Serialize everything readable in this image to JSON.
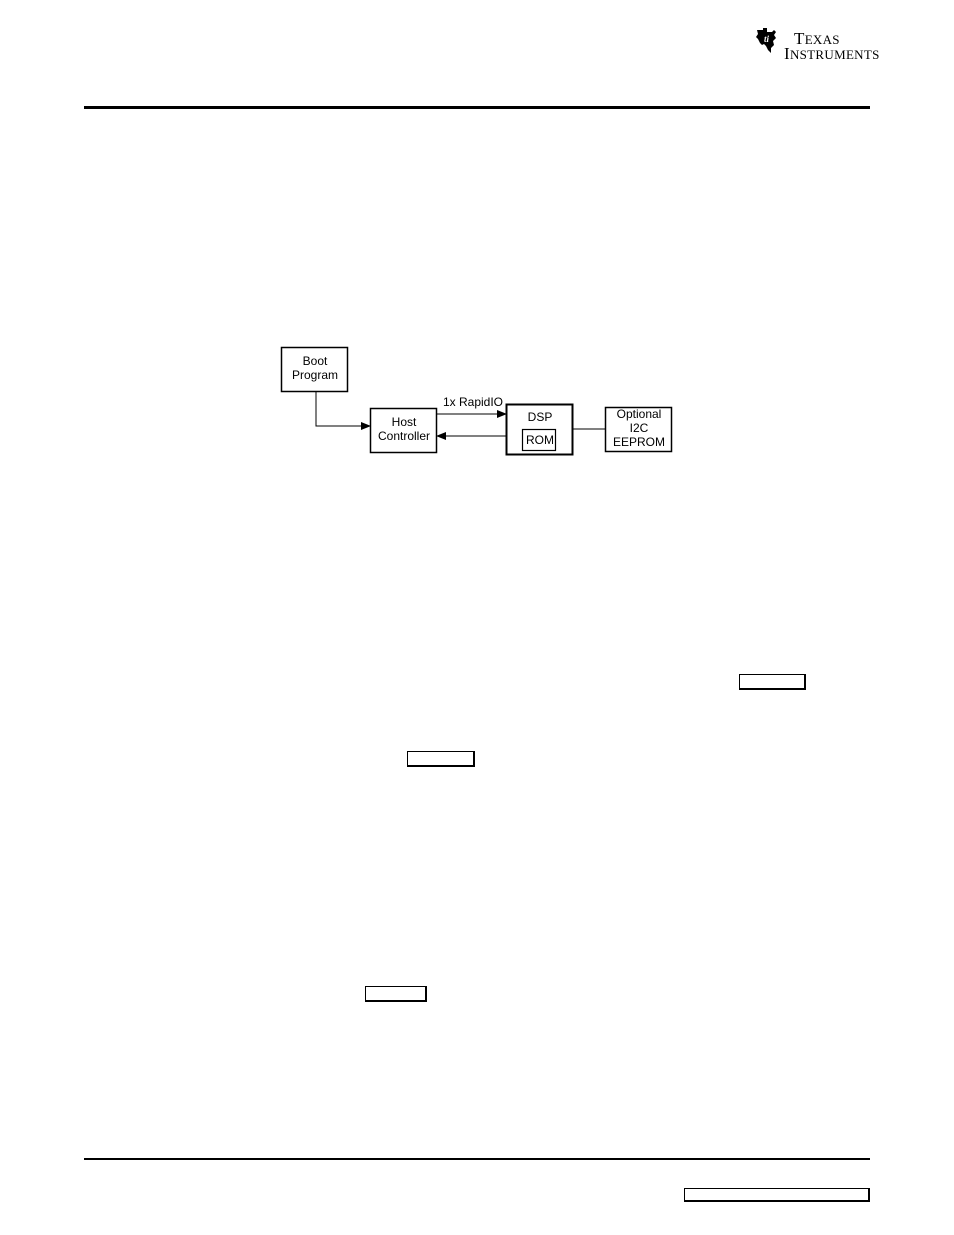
{
  "header": {
    "logo": {
      "icon": "ti-texas-logo-icon",
      "line1_initial": "T",
      "line1_rest": "EXAS",
      "line2_initial": "I",
      "line2_rest": "NSTRUMENTS"
    }
  },
  "figure": {
    "nodes": {
      "boot_program": "Boot\nProgram",
      "host_controller": "Host\nController",
      "dsp": "DSP",
      "rom": "ROM",
      "optional_eeprom": "Optional\nI2C\nEEPROM"
    },
    "edge_label": "1x RapidIO"
  },
  "links": {
    "ref1": "",
    "ref2": "",
    "ref3": "",
    "footer_ref": ""
  }
}
